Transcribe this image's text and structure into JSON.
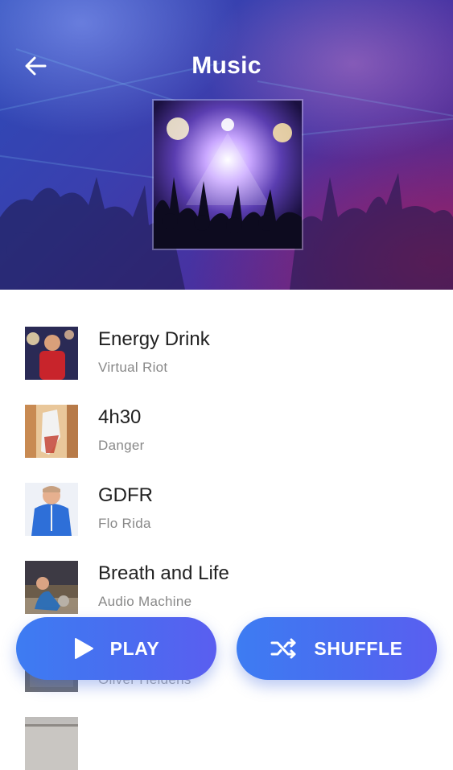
{
  "header": {
    "title": "Music",
    "back_icon": "arrow-left-icon"
  },
  "songs": [
    {
      "title": "Energy Drink",
      "artist": "Virtual Riot"
    },
    {
      "title": "4h30",
      "artist": "Danger"
    },
    {
      "title": "GDFR",
      "artist": "Flo Rida"
    },
    {
      "title": "Breath and Life",
      "artist": "Audio Machine"
    },
    {
      "title": "",
      "artist": "Oliver Heldens"
    },
    {
      "title": "",
      "artist": ""
    }
  ],
  "actions": {
    "play_label": "PLAY",
    "play_icon": "play-icon",
    "shuffle_label": "SHUFFLE",
    "shuffle_icon": "shuffle-icon"
  },
  "colors": {
    "accent": "#4a6cf0",
    "header_start": "#2c4bb8",
    "header_end": "#5a2580",
    "title_text": "#222222",
    "artist_text": "#888888"
  }
}
